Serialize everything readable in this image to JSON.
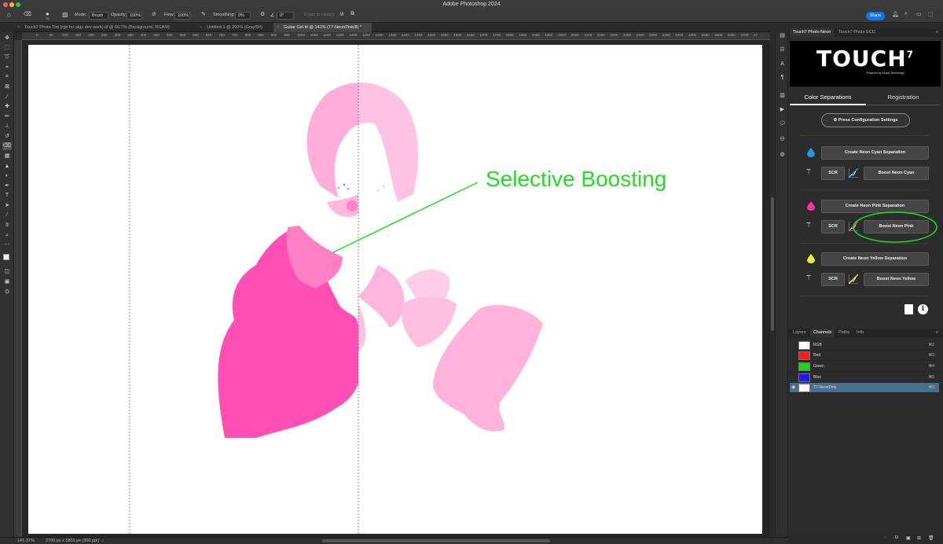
{
  "window": {
    "title": "Adobe Photoshop 2024"
  },
  "options_bar": {
    "brush_size": "79",
    "mode_label": "Mode:",
    "mode_value": "Brush",
    "opacity_label": "Opacity:",
    "opacity_value": "100%",
    "flow_label": "Flow:",
    "flow_value": "100%",
    "smoothing_label": "Smoothing:",
    "smoothing_value": "0%",
    "angle_value": "0°",
    "erase_history": "Erase to History",
    "share_label": "Share"
  },
  "tabs": [
    {
      "label": "Touch7 Photo Tint (rgb for algo dev work).tif @ 66.7% (Background, RGB/8)"
    },
    {
      "label": "Untitled-1 @ 200% (Gray/8#)"
    },
    {
      "label": "Guitar Girl.tif @ 141% (T7-NeonPink/8) *"
    }
  ],
  "ruler_ticks": [
    "0",
    "50",
    "100",
    "150",
    "200",
    "250",
    "300",
    "350",
    "400",
    "450",
    "500",
    "550",
    "600",
    "650",
    "700",
    "750",
    "800",
    "850",
    "900",
    "950",
    "1000",
    "1050",
    "1100",
    "1150",
    "1200",
    "1250",
    "1300",
    "1350",
    "1400",
    "1450",
    "1500",
    "1550",
    "1600",
    "1650",
    "1700",
    "1750",
    "1800",
    "1850",
    "1900",
    "1950",
    "2000",
    "2050",
    "2100",
    "2150",
    "2200",
    "2250",
    "2300",
    "2350",
    "2400",
    "2450",
    "2500",
    "2550",
    "2600",
    "2650",
    "2700",
    "27"
  ],
  "canvas": {
    "annotation_text": "Selective Boosting",
    "annotation_color": "#22dd22",
    "ink_color": "#ff4fb5"
  },
  "status_bar": {
    "zoom": "141.37%",
    "doc_info": "2700 px x 1801 px (300 ppi)"
  },
  "plugin_panel": {
    "tabs": [
      "Touch7 Photo Neon",
      "Touch7 Photo ECG"
    ],
    "logo_text": "TOUCH",
    "logo_superscript": "7",
    "logo_tagline": "Powered by Khaos Technology",
    "section_tabs": [
      "Color Separations",
      "Registration"
    ],
    "config_button": "Press Configuration Settings",
    "cyan": {
      "create": "Create Neon Cyan Separation",
      "scr": "SCR",
      "boost": "Boost Neon Cyan",
      "color": "#1e9be6"
    },
    "pink": {
      "create": "Create Neon Pink Separation",
      "scr": "SCR",
      "boost": "Boost Neon Pink",
      "color": "#ff2fa8"
    },
    "yellow": {
      "create": "Create Neon Yellow Separation",
      "scr": "SCR",
      "boost": "Boost Neon Yellow",
      "color": "#e6ef2a"
    },
    "highlight_color": "#22dd22"
  },
  "channels_panel": {
    "tabs": [
      "Layers",
      "Channels",
      "Paths",
      "Info"
    ],
    "rows": [
      {
        "name": "RGB",
        "shortcut": "⌘2",
        "color": "#ffffff"
      },
      {
        "name": "Red",
        "shortcut": "⌘3",
        "color": "#ff1a1a"
      },
      {
        "name": "Green",
        "shortcut": "⌘4",
        "color": "#1ad61a"
      },
      {
        "name": "Blue",
        "shortcut": "⌘5",
        "color": "#1a1aff"
      },
      {
        "name": "T7-NeonPink",
        "shortcut": "⌘6",
        "color": "#ffffff"
      }
    ]
  }
}
